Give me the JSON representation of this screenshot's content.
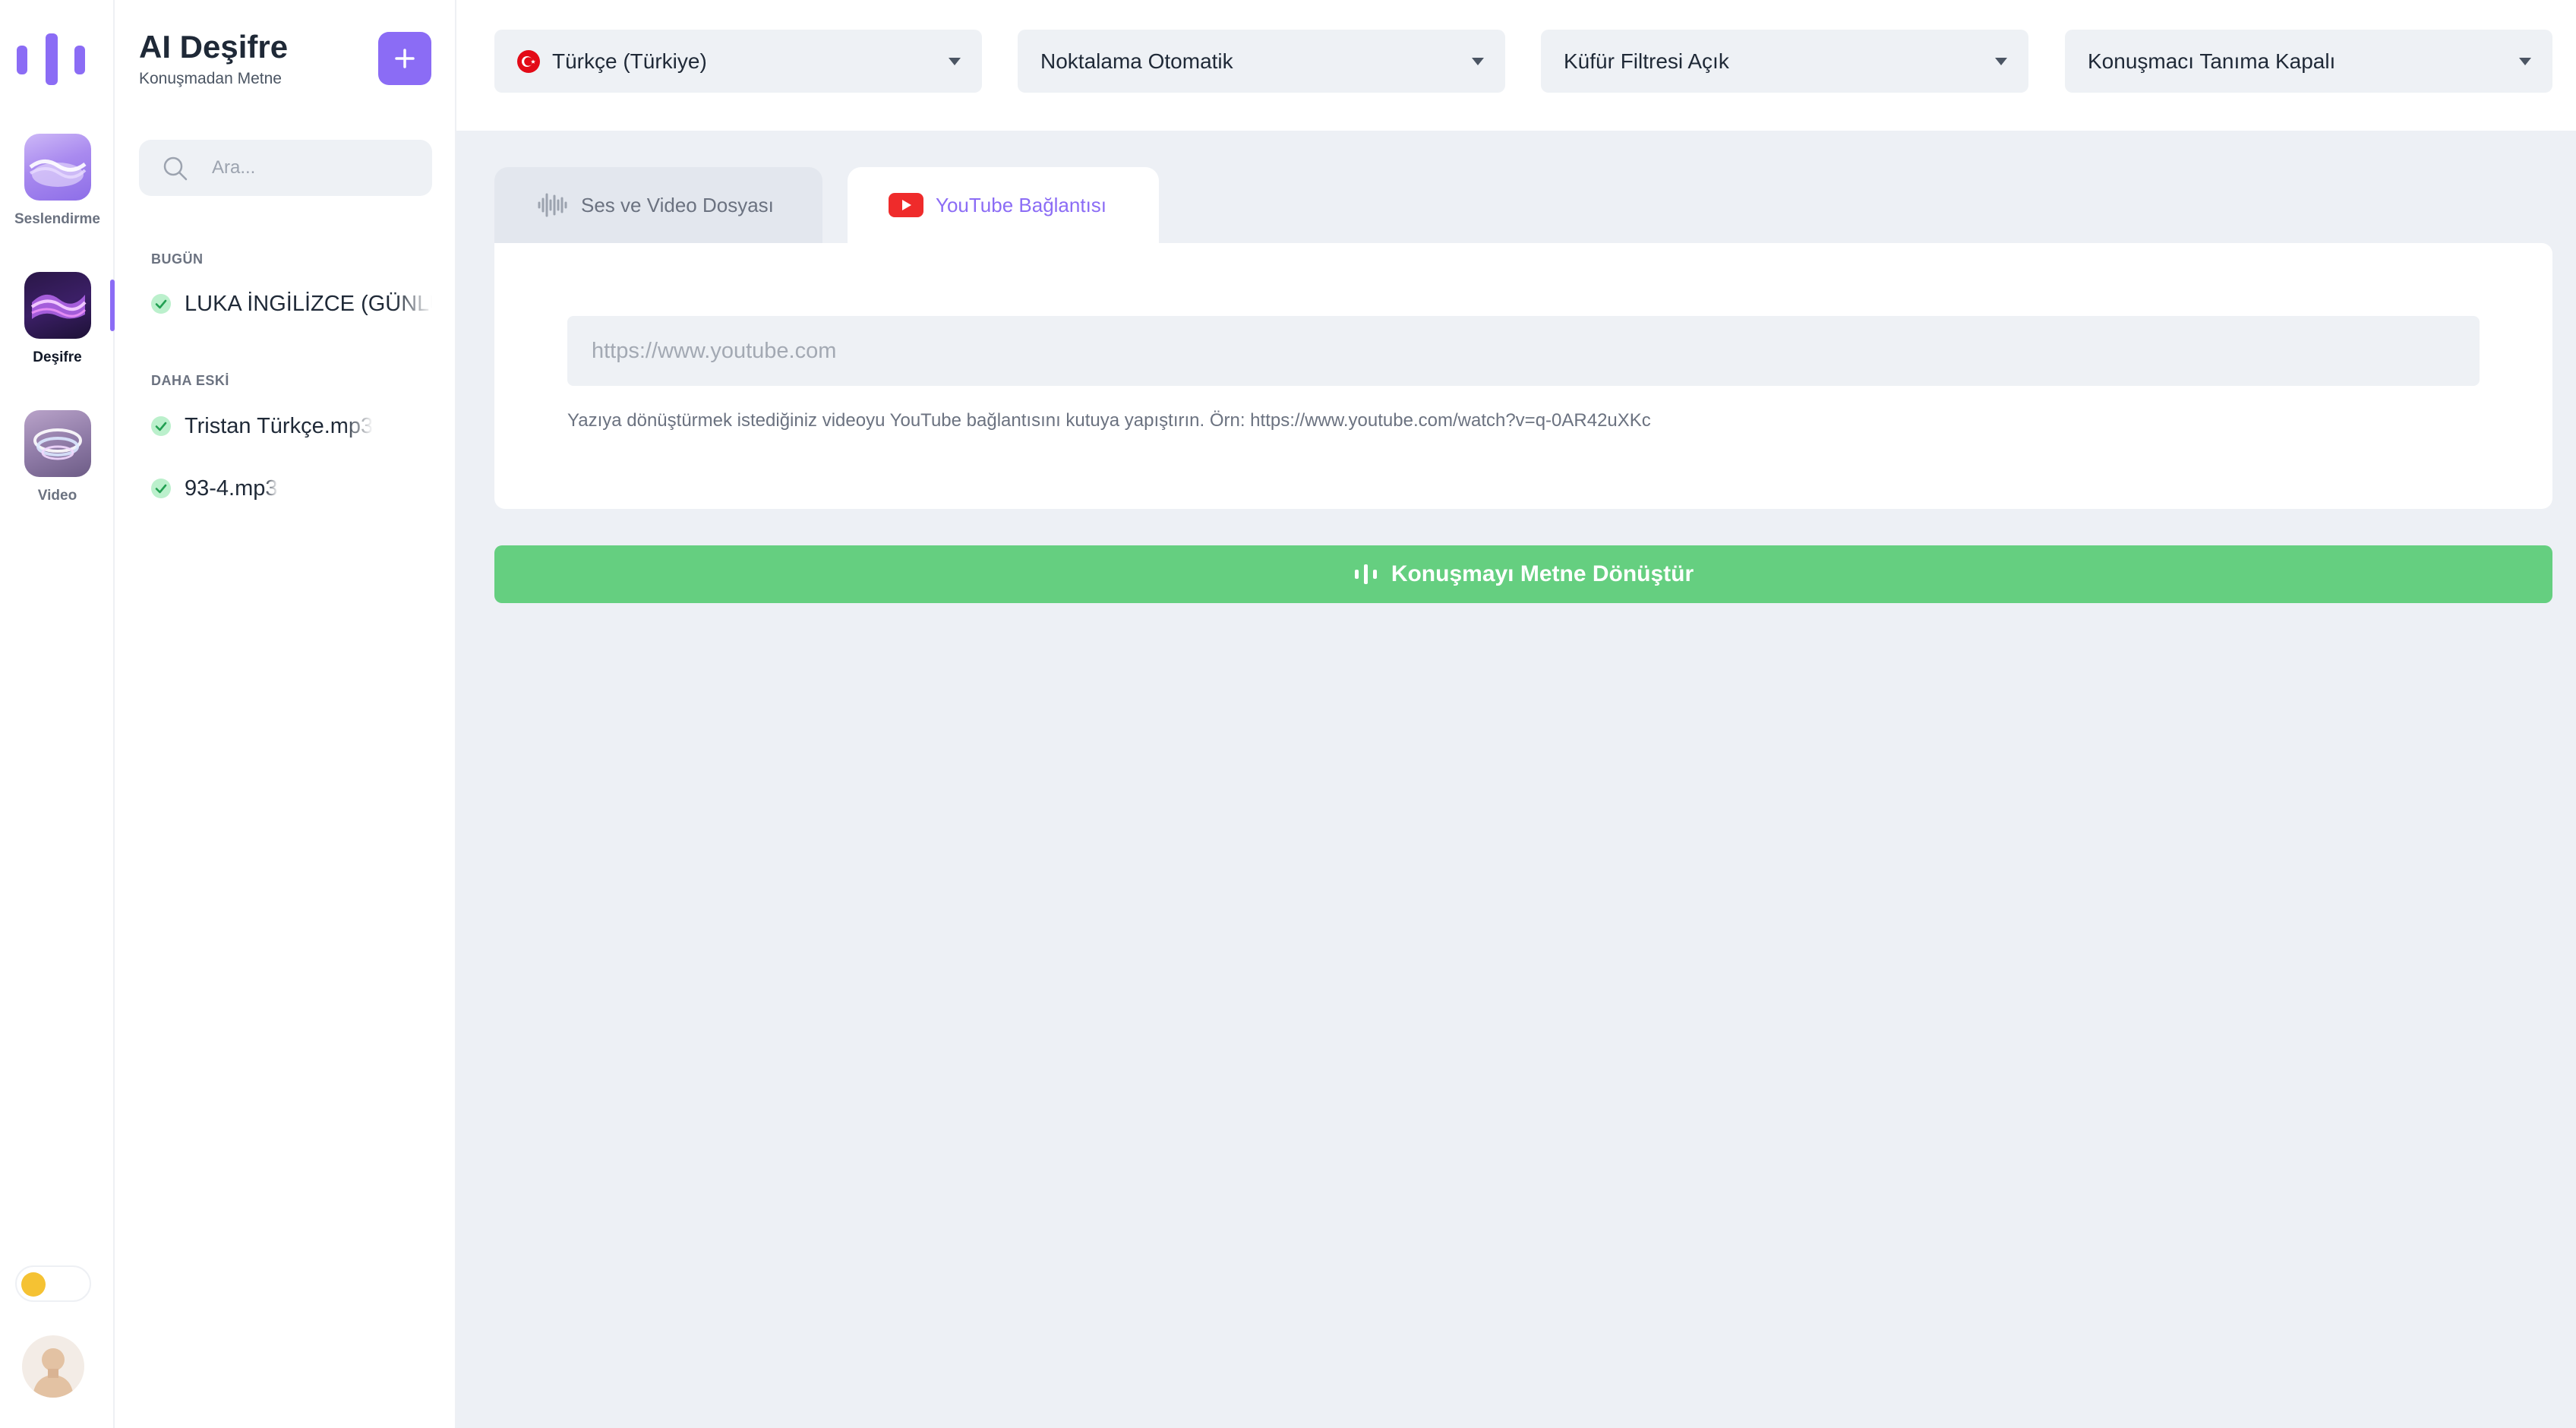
{
  "rail": {
    "logo_icon": "bars-logo-icon",
    "items": [
      {
        "label": "Seslendirme",
        "icon": "voice-wave-icon",
        "active": false
      },
      {
        "label": "Deşifre",
        "icon": "transcribe-wave-icon",
        "active": true
      },
      {
        "label": "Video",
        "icon": "video-swirl-icon",
        "active": false
      }
    ],
    "theme_toggle_icon": "sun-icon",
    "avatar_icon": "user-avatar-icon"
  },
  "panel": {
    "title": "AI Deşifre",
    "subtitle": "Konuşmadan Metne",
    "new_icon": "plus-icon",
    "search_placeholder": "Ara...",
    "sections": [
      {
        "label": "BUGÜN",
        "items": [
          {
            "name": "LUKA İNGİLİZCE (GÜNLÜK)",
            "status_icon": "check-circle-icon"
          }
        ]
      },
      {
        "label": "DAHA ESKİ",
        "items": [
          {
            "name": "Tristan Türkçe.mp3",
            "status_icon": "check-circle-icon"
          },
          {
            "name": "93-4.mp3",
            "status_icon": "check-circle-icon"
          }
        ]
      }
    ]
  },
  "selects": {
    "language": {
      "value": "Türkçe (Türkiye)",
      "flag_icon": "turkey-flag-icon"
    },
    "punctuation": {
      "value": "Noktalama Otomatik"
    },
    "profanity": {
      "value": "Küfür Filtresi Açık"
    },
    "speaker": {
      "value": "Konuşmacı Tanıma Kapalı"
    }
  },
  "tabs": [
    {
      "label": "Ses ve Video Dosyası",
      "icon": "audio-wave-icon",
      "active": false
    },
    {
      "label": "YouTube Bağlantısı",
      "icon": "youtube-icon",
      "active": true
    }
  ],
  "youtube": {
    "url_value": "",
    "url_placeholder": "https://www.youtube.com",
    "hint": "Yazıya dönüştürmek istediğiniz videoyu YouTube bağlantısını kutuya yapıştırın. Örn: https://www.youtube.com/watch?v=q-0AR42uXKc"
  },
  "convert_button": {
    "label": "Konuşmayı Metne Dönüştür",
    "icon": "waveform-icon"
  },
  "colors": {
    "accent": "#8b6cf5",
    "convert_green": "#65cf80",
    "main_background": "#edf0f5",
    "field_background": "#eef1f5",
    "check_green": "#4ade80",
    "youtube_red": "#ef2b2b"
  }
}
